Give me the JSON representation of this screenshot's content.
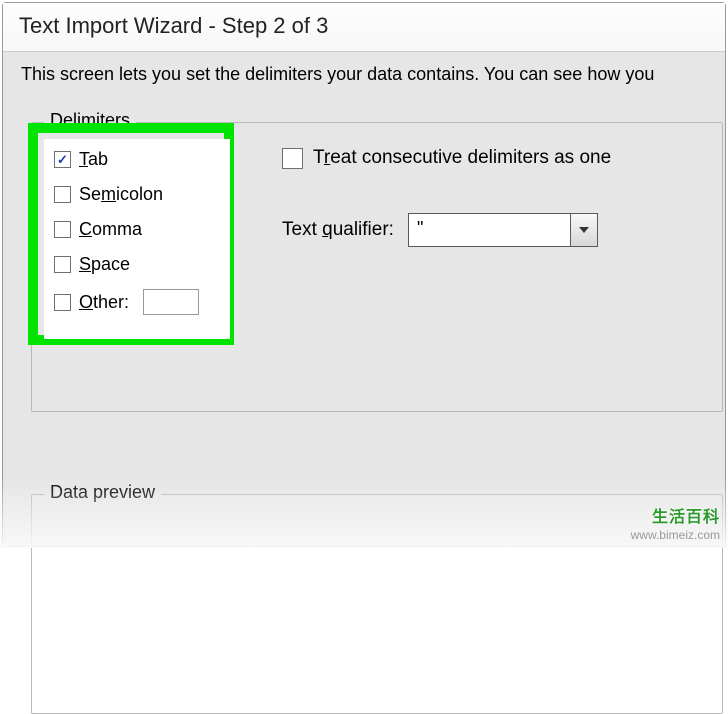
{
  "title": "Text Import Wizard - Step 2 of 3",
  "description": "This screen lets you set the delimiters your data contains.  You can see how you",
  "delimiters": {
    "legend": "Delimiters",
    "items": [
      {
        "label": "Tab",
        "underline": "T",
        "rest": "ab",
        "checked": true
      },
      {
        "label": "Semicolon",
        "underline": "m",
        "pre": "Se",
        "rest": "icolon",
        "checked": false
      },
      {
        "label": "Comma",
        "underline": "C",
        "rest": "omma",
        "checked": false
      },
      {
        "label": "Space",
        "underline": "S",
        "rest": "pace",
        "checked": false
      },
      {
        "label": "Other:",
        "underline": "O",
        "rest": "ther:",
        "checked": false
      }
    ],
    "other_value": ""
  },
  "treat_consecutive": {
    "label_pre": "T",
    "label_underline": "r",
    "label_post": "eat consecutive delimiters as one",
    "checked": false
  },
  "text_qualifier": {
    "label_pre": "Text ",
    "label_underline": "q",
    "label_post": "ualifier:",
    "value": "\""
  },
  "data_preview": {
    "legend_pre": "Data ",
    "legend_underline": "p",
    "legend_post": "review"
  },
  "watermark": {
    "site": "生活百科",
    "url": "www.bimeiz.com"
  }
}
